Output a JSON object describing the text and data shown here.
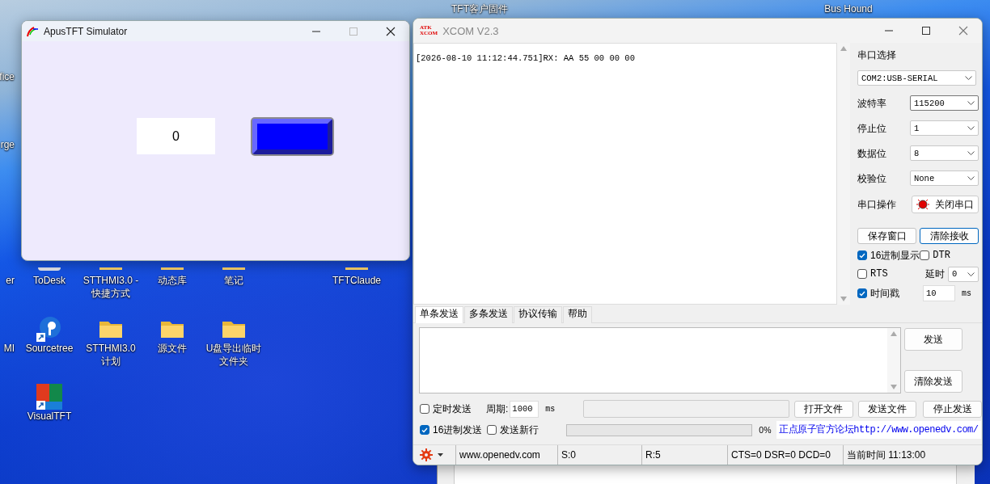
{
  "desktop": {
    "icons": [
      {
        "label": "TFT客户固件",
        "kind": "text"
      },
      {
        "label": "Bus Hound",
        "kind": "text"
      },
      {
        "label": "fice",
        "kind": "edge"
      },
      {
        "label": "rge",
        "kind": "edge"
      },
      {
        "label": "er",
        "kind": "edge"
      },
      {
        "label": "ToDesk",
        "kind": "app"
      },
      {
        "label": "STTHMI3.0 - 快捷方式",
        "kind": "folder"
      },
      {
        "label": "动态库",
        "kind": "folder"
      },
      {
        "label": "笔记",
        "kind": "folder"
      },
      {
        "label": "TFTClaude",
        "kind": "folder"
      },
      {
        "label": "MI",
        "kind": "edge"
      },
      {
        "label": "Sourcetree",
        "kind": "sourcetree",
        "shortcut": true
      },
      {
        "label": "STTHMI3.0 计划",
        "kind": "folder",
        "shortcut": false
      },
      {
        "label": "源文件",
        "kind": "folder",
        "shortcut": false
      },
      {
        "label": "U盘导出临时文件夹",
        "kind": "folder",
        "shortcut": false
      },
      {
        "label": "VisualTFT",
        "kind": "visualtft",
        "shortcut": true
      }
    ]
  },
  "simulator": {
    "title": "ApusTFT Simulator",
    "display_value": "0"
  },
  "xcom": {
    "title": "XCOM V2.3",
    "logo": [
      "ATK",
      "XCOM"
    ],
    "receive_log": "[2026-08-10 11:12:44.751]RX: AA 55 00 00 00",
    "port_heading": "串口选择",
    "port": "COM2:USB-SERIAL",
    "settings": [
      {
        "label": "波特率",
        "value": "115200"
      },
      {
        "label": "停止位",
        "value": "1"
      },
      {
        "label": "数据位",
        "value": "8"
      },
      {
        "label": "校验位",
        "value": "None"
      }
    ],
    "port_operation": {
      "label": "串口操作",
      "button": "关闭串口",
      "open": true
    },
    "receive_buttons": [
      {
        "label": "保存窗口",
        "focused": false
      },
      {
        "label": "清除接收",
        "focused": true
      }
    ],
    "hex_display": {
      "label": "16进制显示",
      "checked": true
    },
    "dtr": {
      "label": "DTR",
      "checked": false
    },
    "rts": {
      "label": "RTS",
      "checked": false
    },
    "delay": {
      "label": "延时",
      "value": "0"
    },
    "timestamp": {
      "label": "时间戳",
      "checked": true,
      "value": "10",
      "unit": "ms"
    },
    "tabs": [
      {
        "label": "单条发送",
        "selected": true
      },
      {
        "label": "多条发送",
        "selected": false
      },
      {
        "label": "协议传输",
        "selected": false
      },
      {
        "label": "帮助",
        "selected": false
      }
    ],
    "send_buttons": [
      "发送",
      "清除发送"
    ],
    "timed_send": {
      "label": "定时发送",
      "checked": false
    },
    "period": {
      "label": "周期:",
      "value": "1000",
      "unit": "ms"
    },
    "file_buttons": [
      "打开文件",
      "发送文件",
      "停止发送"
    ],
    "hex_send": {
      "label": "16进制发送",
      "checked": true
    },
    "send_newline": {
      "label": "发送新行",
      "checked": false
    },
    "progress": {
      "level": 0,
      "reading": "0%"
    },
    "forum_link": "正点原子官方论坛http://www.openedv.com/",
    "status_bar": [
      "www.openedv.com",
      "S:0",
      "R:5",
      "CTS=0 DSR=0 DCD=0",
      "当前时间 11:13:00"
    ]
  }
}
